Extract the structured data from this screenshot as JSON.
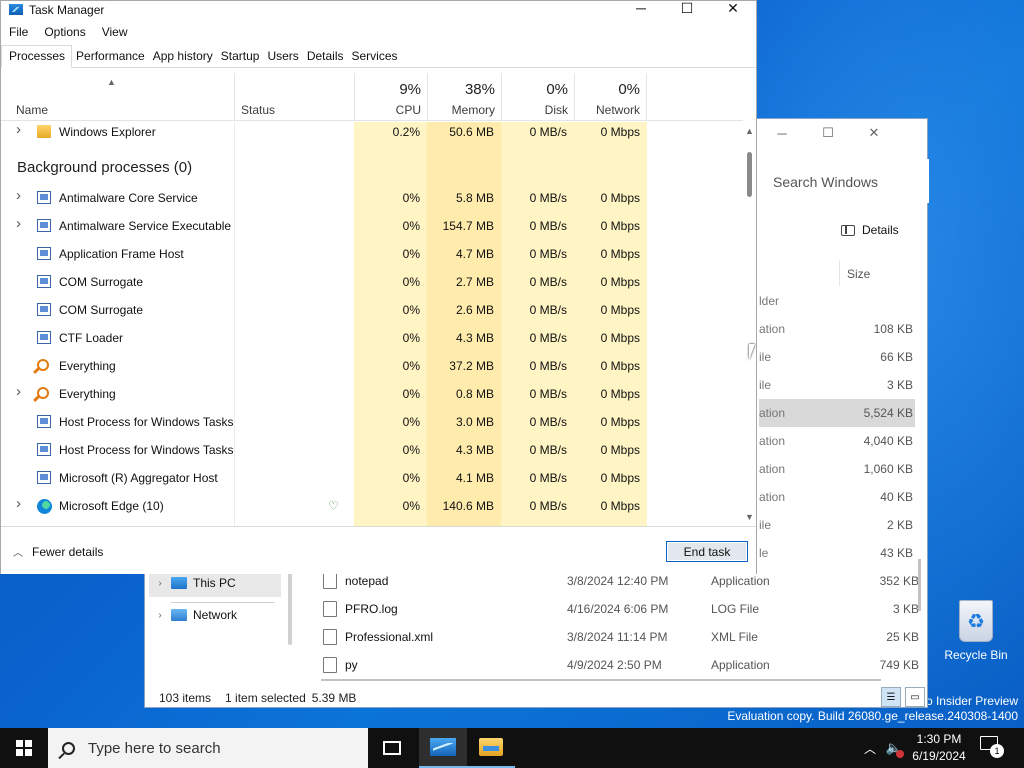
{
  "desktop": {
    "recycle_bin_label": "Recycle Bin",
    "watermark_line1": "ro Insider Preview",
    "watermark_line2": "Evaluation copy. Build 26080.ge_release.240308-1400"
  },
  "explorer": {
    "search_placeholder": "Search Windows",
    "details_label": "Details",
    "size_header": "Size",
    "partial_rows": [
      {
        "type": "lder",
        "size": ""
      },
      {
        "type": "ation",
        "size": "108 KB"
      },
      {
        "type": "ile",
        "size": "66 KB"
      },
      {
        "type": "ile",
        "size": "3 KB"
      },
      {
        "type": "ation",
        "size": "5,524 KB",
        "selected": true
      },
      {
        "type": "ation",
        "size": "4,040 KB"
      },
      {
        "type": "ation",
        "size": "1,060 KB"
      },
      {
        "type": "ation",
        "size": "40 KB"
      },
      {
        "type": "ile",
        "size": "2 KB"
      },
      {
        "type": "le",
        "size": "43 KB"
      }
    ],
    "nav": {
      "this_pc": "This PC",
      "network": "Network"
    },
    "files": [
      {
        "name": "notepad",
        "date": "3/8/2024 12:40 PM",
        "type": "Application",
        "size": "352 KB"
      },
      {
        "name": "PFRO.log",
        "date": "4/16/2024 6:06 PM",
        "type": "LOG File",
        "size": "3 KB"
      },
      {
        "name": "Professional.xml",
        "date": "3/8/2024 11:14 PM",
        "type": "XML File",
        "size": "25 KB"
      },
      {
        "name": "py",
        "date": "4/9/2024 2:50 PM",
        "type": "Application",
        "size": "749 KB"
      }
    ],
    "status": {
      "items": "103 items",
      "selected": "1 item selected",
      "size": "5.39 MB"
    }
  },
  "taskmgr": {
    "title": "Task Manager",
    "menu": [
      "File",
      "Options",
      "View"
    ],
    "tabs": [
      "Processes",
      "Performance",
      "App history",
      "Startup",
      "Users",
      "Details",
      "Services"
    ],
    "active_tab": "Processes",
    "columns": {
      "name": "Name",
      "status": "Status",
      "cpu": {
        "pct": "9%",
        "label": "CPU"
      },
      "memory": {
        "pct": "38%",
        "label": "Memory"
      },
      "disk": {
        "pct": "0%",
        "label": "Disk"
      },
      "network": {
        "pct": "0%",
        "label": "Network"
      }
    },
    "apps": [
      {
        "name": "Windows Explorer",
        "cpu": "0.2%",
        "memory": "50.6 MB",
        "disk": "0 MB/s",
        "network": "0 Mbps",
        "icon": "folder-icon",
        "expandable": true
      }
    ],
    "background_title": "Background processes (0)",
    "processes": [
      {
        "name": "Antimalware Core Service",
        "cpu": "0%",
        "memory": "5.8 MB",
        "disk": "0 MB/s",
        "network": "0 Mbps",
        "icon": "window-icon",
        "expandable": true
      },
      {
        "name": "Antimalware Service Executable",
        "cpu": "0%",
        "memory": "154.7 MB",
        "disk": "0 MB/s",
        "network": "0 Mbps",
        "icon": "window-icon",
        "expandable": true
      },
      {
        "name": "Application Frame Host",
        "cpu": "0%",
        "memory": "4.7 MB",
        "disk": "0 MB/s",
        "network": "0 Mbps",
        "icon": "window-icon",
        "expandable": false
      },
      {
        "name": "COM Surrogate",
        "cpu": "0%",
        "memory": "2.7 MB",
        "disk": "0 MB/s",
        "network": "0 Mbps",
        "icon": "window-icon",
        "expandable": false
      },
      {
        "name": "COM Surrogate",
        "cpu": "0%",
        "memory": "2.6 MB",
        "disk": "0 MB/s",
        "network": "0 Mbps",
        "icon": "window-icon",
        "expandable": false
      },
      {
        "name": "CTF Loader",
        "cpu": "0%",
        "memory": "4.3 MB",
        "disk": "0 MB/s",
        "network": "0 Mbps",
        "icon": "window-icon",
        "expandable": false
      },
      {
        "name": "Everything",
        "cpu": "0%",
        "memory": "37.2 MB",
        "disk": "0 MB/s",
        "network": "0 Mbps",
        "icon": "search-icon",
        "expandable": false
      },
      {
        "name": "Everything",
        "cpu": "0%",
        "memory": "0.8 MB",
        "disk": "0 MB/s",
        "network": "0 Mbps",
        "icon": "search-icon",
        "expandable": true
      },
      {
        "name": "Host Process for Windows Tasks",
        "cpu": "0%",
        "memory": "3.0 MB",
        "disk": "0 MB/s",
        "network": "0 Mbps",
        "icon": "window-icon",
        "expandable": false
      },
      {
        "name": "Host Process for Windows Tasks",
        "cpu": "0%",
        "memory": "4.3 MB",
        "disk": "0 MB/s",
        "network": "0 Mbps",
        "icon": "window-icon",
        "expandable": false
      },
      {
        "name": "Microsoft (R) Aggregator Host",
        "cpu": "0%",
        "memory": "4.1 MB",
        "disk": "0 MB/s",
        "network": "0 Mbps",
        "icon": "window-icon",
        "expandable": false
      },
      {
        "name": "Microsoft Edge (10)",
        "cpu": "0%",
        "memory": "140.6 MB",
        "disk": "0 MB/s",
        "network": "0 Mbps",
        "icon": "edge-icon",
        "expandable": true,
        "efficiency": true
      }
    ],
    "footer": {
      "fewer_details": "Fewer details",
      "end_task": "End task"
    }
  },
  "taskbar": {
    "search_placeholder": "Type here to search",
    "time": "1:30 PM",
    "date": "6/19/2024",
    "notification_count": "1"
  }
}
